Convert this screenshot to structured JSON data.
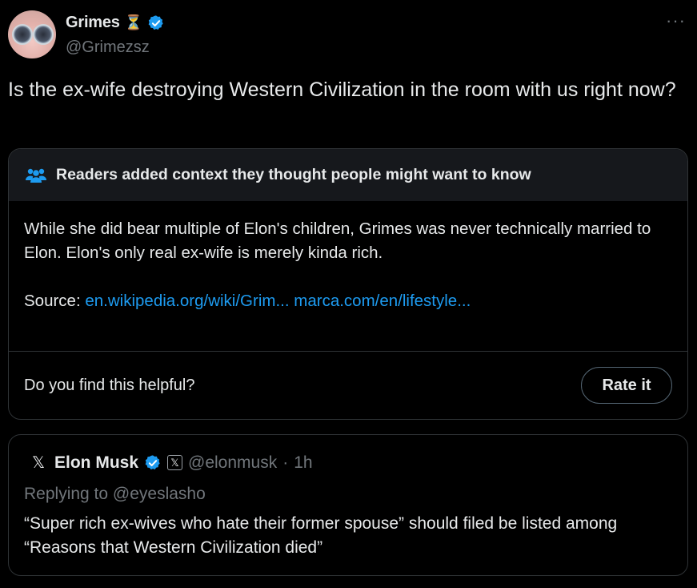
{
  "author": {
    "name": "Grimes",
    "emoji": "⏳",
    "handle": "@Grimezsz",
    "verified_color": "#1d9bf0"
  },
  "more_label": "···",
  "tweet": {
    "text": "Is the ex-wife destroying Western Civilization in the room with us right now?"
  },
  "community_note": {
    "title": "Readers added context they thought people might want to know",
    "body": "While she did bear multiple of Elon's children, Grimes was never technically married to Elon. Elon's only real ex-wife is merely kinda rich.",
    "source_label": "Source:",
    "links": [
      "en.wikipedia.org/wiki/Grim...",
      "marca.com/en/lifestyle..."
    ],
    "question": "Do you find this helpful?",
    "rate_label": "Rate it"
  },
  "quoted": {
    "x_logo": "𝕏",
    "name": "Elon Musk",
    "badge": "𝕏",
    "handle": "@elonmusk",
    "separator": "·",
    "time": "1h",
    "replying_to": "Replying to @eyeslasho",
    "text": "“Super rich ex-wives who hate their former spouse” should filed be listed among “Reasons that Western Civilization died”"
  },
  "colors": {
    "accent": "#1d9bf0",
    "muted": "#71767b",
    "border": "#2f3336",
    "background": "#000000"
  }
}
